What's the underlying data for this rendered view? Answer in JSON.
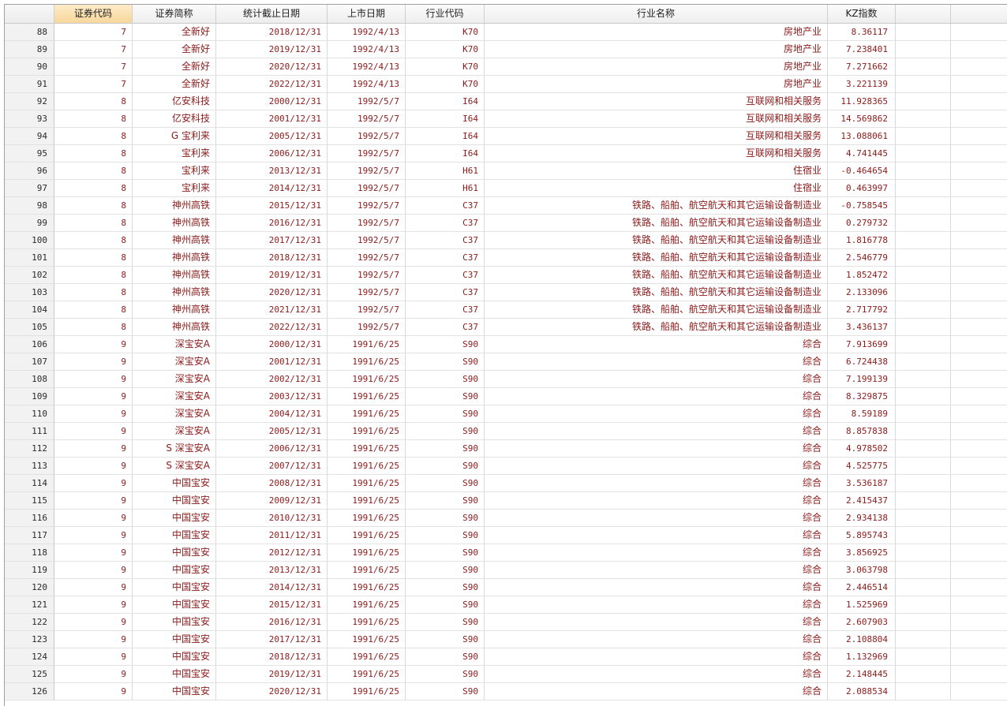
{
  "headers": [
    "",
    "证券代码",
    "证券简称",
    "统计截止日期",
    "上市日期",
    "行业代码",
    "行业名称",
    "KZ指数",
    "",
    ""
  ],
  "rows": [
    [
      "88",
      "7",
      "全新好",
      "2018/12/31",
      "1992/4/13",
      "K70",
      "房地产业",
      "8.36117"
    ],
    [
      "89",
      "7",
      "全新好",
      "2019/12/31",
      "1992/4/13",
      "K70",
      "房地产业",
      "7.238401"
    ],
    [
      "90",
      "7",
      "全新好",
      "2020/12/31",
      "1992/4/13",
      "K70",
      "房地产业",
      "7.271662"
    ],
    [
      "91",
      "7",
      "全新好",
      "2022/12/31",
      "1992/4/13",
      "K70",
      "房地产业",
      "3.221139"
    ],
    [
      "92",
      "8",
      "亿安科技",
      "2000/12/31",
      "1992/5/7",
      "I64",
      "互联网和相关服务",
      "11.928365"
    ],
    [
      "93",
      "8",
      "亿安科技",
      "2001/12/31",
      "1992/5/7",
      "I64",
      "互联网和相关服务",
      "14.569862"
    ],
    [
      "94",
      "8",
      "G 宝利来",
      "2005/12/31",
      "1992/5/7",
      "I64",
      "互联网和相关服务",
      "13.088061"
    ],
    [
      "95",
      "8",
      "宝利来",
      "2006/12/31",
      "1992/5/7",
      "I64",
      "互联网和相关服务",
      "4.741445"
    ],
    [
      "96",
      "8",
      "宝利来",
      "2013/12/31",
      "1992/5/7",
      "H61",
      "住宿业",
      "-0.464654"
    ],
    [
      "97",
      "8",
      "宝利来",
      "2014/12/31",
      "1992/5/7",
      "H61",
      "住宿业",
      "0.463997"
    ],
    [
      "98",
      "8",
      "神州高铁",
      "2015/12/31",
      "1992/5/7",
      "C37",
      "铁路、船舶、航空航天和其它运输设备制造业",
      "-0.758545"
    ],
    [
      "99",
      "8",
      "神州高铁",
      "2016/12/31",
      "1992/5/7",
      "C37",
      "铁路、船舶、航空航天和其它运输设备制造业",
      "0.279732"
    ],
    [
      "100",
      "8",
      "神州高铁",
      "2017/12/31",
      "1992/5/7",
      "C37",
      "铁路、船舶、航空航天和其它运输设备制造业",
      "1.816778"
    ],
    [
      "101",
      "8",
      "神州高铁",
      "2018/12/31",
      "1992/5/7",
      "C37",
      "铁路、船舶、航空航天和其它运输设备制造业",
      "2.546779"
    ],
    [
      "102",
      "8",
      "神州高铁",
      "2019/12/31",
      "1992/5/7",
      "C37",
      "铁路、船舶、航空航天和其它运输设备制造业",
      "1.852472"
    ],
    [
      "103",
      "8",
      "神州高铁",
      "2020/12/31",
      "1992/5/7",
      "C37",
      "铁路、船舶、航空航天和其它运输设备制造业",
      "2.133096"
    ],
    [
      "104",
      "8",
      "神州高铁",
      "2021/12/31",
      "1992/5/7",
      "C37",
      "铁路、船舶、航空航天和其它运输设备制造业",
      "2.717792"
    ],
    [
      "105",
      "8",
      "神州高铁",
      "2022/12/31",
      "1992/5/7",
      "C37",
      "铁路、船舶、航空航天和其它运输设备制造业",
      "3.436137"
    ],
    [
      "106",
      "9",
      "深宝安A",
      "2000/12/31",
      "1991/6/25",
      "S90",
      "综合",
      "7.913699"
    ],
    [
      "107",
      "9",
      "深宝安A",
      "2001/12/31",
      "1991/6/25",
      "S90",
      "综合",
      "6.724438"
    ],
    [
      "108",
      "9",
      "深宝安A",
      "2002/12/31",
      "1991/6/25",
      "S90",
      "综合",
      "7.199139"
    ],
    [
      "109",
      "9",
      "深宝安A",
      "2003/12/31",
      "1991/6/25",
      "S90",
      "综合",
      "8.329875"
    ],
    [
      "110",
      "9",
      "深宝安A",
      "2004/12/31",
      "1991/6/25",
      "S90",
      "综合",
      "8.59189"
    ],
    [
      "111",
      "9",
      "深宝安A",
      "2005/12/31",
      "1991/6/25",
      "S90",
      "综合",
      "8.857838"
    ],
    [
      "112",
      "9",
      "S 深宝安A",
      "2006/12/31",
      "1991/6/25",
      "S90",
      "综合",
      "4.978502"
    ],
    [
      "113",
      "9",
      "S 深宝安A",
      "2007/12/31",
      "1991/6/25",
      "S90",
      "综合",
      "4.525775"
    ],
    [
      "114",
      "9",
      "中国宝安",
      "2008/12/31",
      "1991/6/25",
      "S90",
      "综合",
      "3.536187"
    ],
    [
      "115",
      "9",
      "中国宝安",
      "2009/12/31",
      "1991/6/25",
      "S90",
      "综合",
      "2.415437"
    ],
    [
      "116",
      "9",
      "中国宝安",
      "2010/12/31",
      "1991/6/25",
      "S90",
      "综合",
      "2.934138"
    ],
    [
      "117",
      "9",
      "中国宝安",
      "2011/12/31",
      "1991/6/25",
      "S90",
      "综合",
      "5.895743"
    ],
    [
      "118",
      "9",
      "中国宝安",
      "2012/12/31",
      "1991/6/25",
      "S90",
      "综合",
      "3.856925"
    ],
    [
      "119",
      "9",
      "中国宝安",
      "2013/12/31",
      "1991/6/25",
      "S90",
      "综合",
      "3.063798"
    ],
    [
      "120",
      "9",
      "中国宝安",
      "2014/12/31",
      "1991/6/25",
      "S90",
      "综合",
      "2.446514"
    ],
    [
      "121",
      "9",
      "中国宝安",
      "2015/12/31",
      "1991/6/25",
      "S90",
      "综合",
      "1.525969"
    ],
    [
      "122",
      "9",
      "中国宝安",
      "2016/12/31",
      "1991/6/25",
      "S90",
      "综合",
      "2.607903"
    ],
    [
      "123",
      "9",
      "中国宝安",
      "2017/12/31",
      "1991/6/25",
      "S90",
      "综合",
      "2.108804"
    ],
    [
      "124",
      "9",
      "中国宝安",
      "2018/12/31",
      "1991/6/25",
      "S90",
      "综合",
      "1.132969"
    ],
    [
      "125",
      "9",
      "中国宝安",
      "2019/12/31",
      "1991/6/25",
      "S90",
      "综合",
      "2.148445"
    ],
    [
      "126",
      "9",
      "中国宝安",
      "2020/12/31",
      "1991/6/25",
      "S90",
      "综合",
      "2.088534"
    ]
  ],
  "colors": {
    "cell_text": "#8b1a1a",
    "active_header": "#f7d79a",
    "row_number_bg": "#f2f2f2"
  }
}
